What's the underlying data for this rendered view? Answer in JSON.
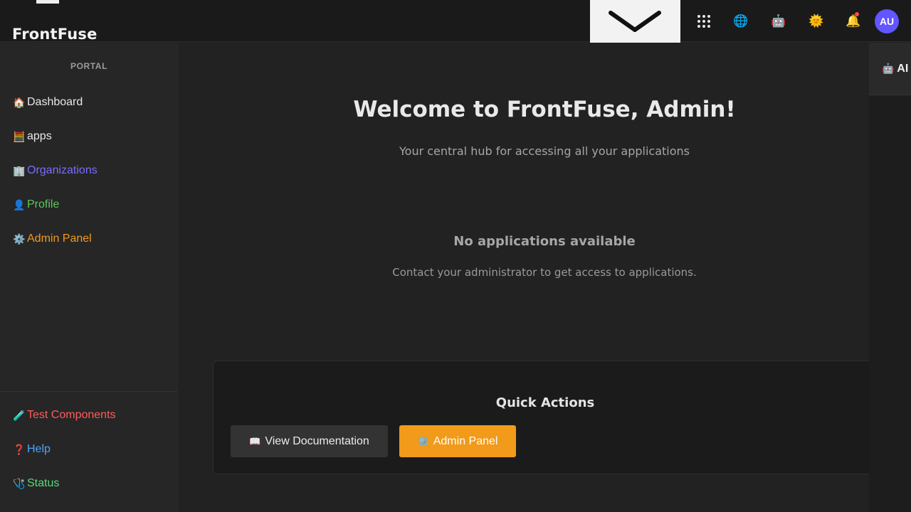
{
  "header": {
    "brand": "FrontFuse",
    "icons": {
      "apps_grid": "⋮⋮⋮",
      "globe": "🌐",
      "robot": "🤖",
      "sun": "🌞",
      "bell": "🔔"
    },
    "avatar_initials": "AU",
    "avatar_color": "#6156ff"
  },
  "sidebar": {
    "section_label": "PORTAL",
    "items": [
      {
        "icon": "🏠",
        "label": "Dashboard",
        "color": "#e8e8e8"
      },
      {
        "icon": "🧮",
        "label": "apps",
        "color": "#e8e8e8"
      },
      {
        "icon": "🏢",
        "label": "Organizations",
        "color": "#7a6cff"
      },
      {
        "icon": "👤",
        "label": "Profile",
        "color": "#5cc85c"
      },
      {
        "icon": "⚙️",
        "label": "Admin Panel",
        "color": "#f29a1a"
      }
    ],
    "bottom_items": [
      {
        "icon": "🧪",
        "label": "Test Components",
        "color": "#ff5c5c"
      },
      {
        "icon": "❓",
        "label": "Help",
        "color": "#4aa6ff"
      },
      {
        "icon": "🩺",
        "label": "Status",
        "color": "#5cd87a"
      }
    ]
  },
  "main": {
    "welcome_title": "Welcome to FrontFuse, Admin!",
    "welcome_subtitle": "Your central hub for accessing all your applications",
    "empty_title": "No applications available",
    "empty_subtitle": "Contact your administrator to get access to applications.",
    "quick_actions": {
      "title": "Quick Actions",
      "doc_icon": "📖",
      "doc_label": "View Documentation",
      "admin_icon": "⚙️",
      "admin_label": "Admin Panel"
    }
  },
  "right_panel": {
    "icon": "🤖",
    "title": "AI"
  }
}
